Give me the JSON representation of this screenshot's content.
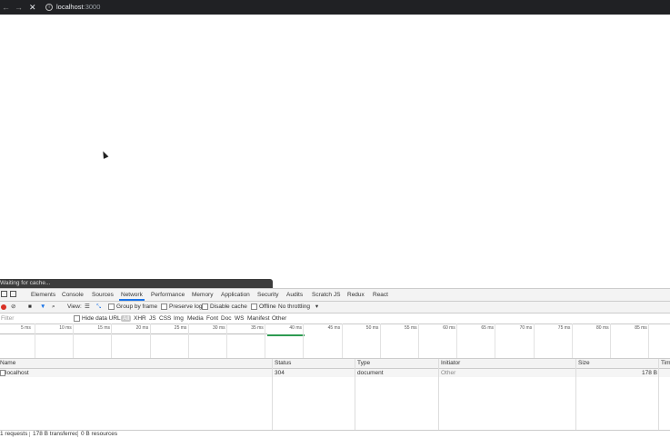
{
  "browser": {
    "back_glyph": "←",
    "forward_glyph": "→",
    "stop_glyph": "✕",
    "info_glyph": "i",
    "host": "localhost",
    "port": ":3000"
  },
  "status_bar": {
    "text": "Waiting for cache..."
  },
  "devtools": {
    "tabs": [
      {
        "label": "Elements"
      },
      {
        "label": "Console"
      },
      {
        "label": "Sources"
      },
      {
        "label": "Network"
      },
      {
        "label": "Performance"
      },
      {
        "label": "Memory"
      },
      {
        "label": "Application"
      },
      {
        "label": "Security"
      },
      {
        "label": "Audits"
      },
      {
        "label": "Scratch JS"
      },
      {
        "label": "Redux"
      },
      {
        "label": "React"
      }
    ],
    "active_tab": "Network",
    "toolbar": {
      "view_label": "View:",
      "group_by_frame": "Group by frame",
      "preserve_log": "Preserve log",
      "disable_cache": "Disable cache",
      "offline": "Offline",
      "throttling": "No throttling",
      "dropdown_glyph": "▾"
    },
    "filter": {
      "placeholder": "Filter",
      "hide_data_urls": "Hide data URLs",
      "types": [
        "All",
        "XHR",
        "JS",
        "CSS",
        "Img",
        "Media",
        "Font",
        "Doc",
        "WS",
        "Manifest",
        "Other"
      ]
    },
    "timeline_ticks": [
      "5 ms",
      "10 ms",
      "15 ms",
      "20 ms",
      "25 ms",
      "30 ms",
      "35 ms",
      "40 ms",
      "45 ms",
      "50 ms",
      "55 ms",
      "60 ms",
      "65 ms",
      "70 ms",
      "75 ms",
      "80 ms",
      "85 ms"
    ],
    "table": {
      "columns": [
        "Name",
        "Status",
        "Type",
        "Initiator",
        "Size",
        "Time"
      ],
      "rows": [
        {
          "name": "localhost",
          "status": "304",
          "type": "document",
          "initiator": "Other",
          "size": "178 B"
        }
      ]
    },
    "footer": {
      "requests": "1 requests",
      "transferred": "178 B transferred",
      "resources": "0 B resources"
    }
  }
}
